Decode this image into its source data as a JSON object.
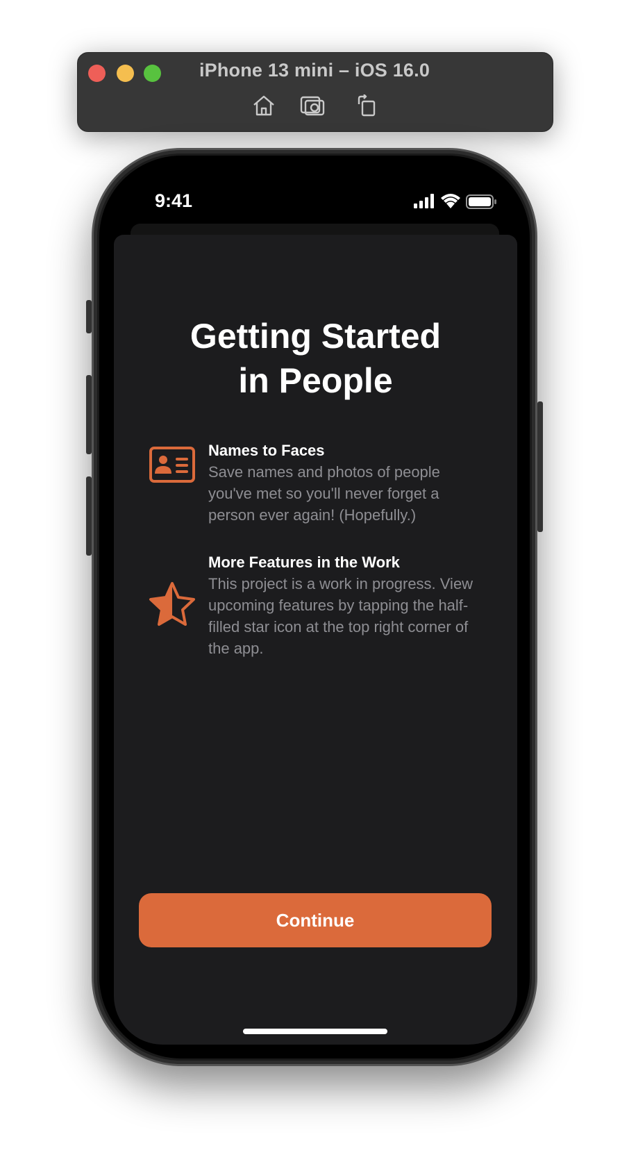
{
  "simulator": {
    "title": "iPhone 13 mini – iOS 16.0",
    "toolbar_icons": [
      "home-icon",
      "screenshot-icon",
      "rotate-icon"
    ]
  },
  "status_bar": {
    "time": "9:41",
    "icons": [
      "cellular-signal-icon",
      "wifi-icon",
      "battery-icon"
    ]
  },
  "onboarding": {
    "title_line1": "Getting Started",
    "title_line2": "in People",
    "features": [
      {
        "icon": "person-id-card-icon",
        "title": "Names to Faces",
        "description": "Save names and photos of people you've met so you'll never forget a person ever again! (Hopefully.)"
      },
      {
        "icon": "half-filled-star-icon",
        "title": "More Features in the Work",
        "description": "This project is a work in progress. View upcoming features by tapping the half-filled star icon at the top right corner of the app."
      }
    ],
    "continue_label": "Continue"
  },
  "colors": {
    "accent": "#db6a3b",
    "sheet_background": "#1c1c1e",
    "secondary_text": "#8e8e93"
  }
}
